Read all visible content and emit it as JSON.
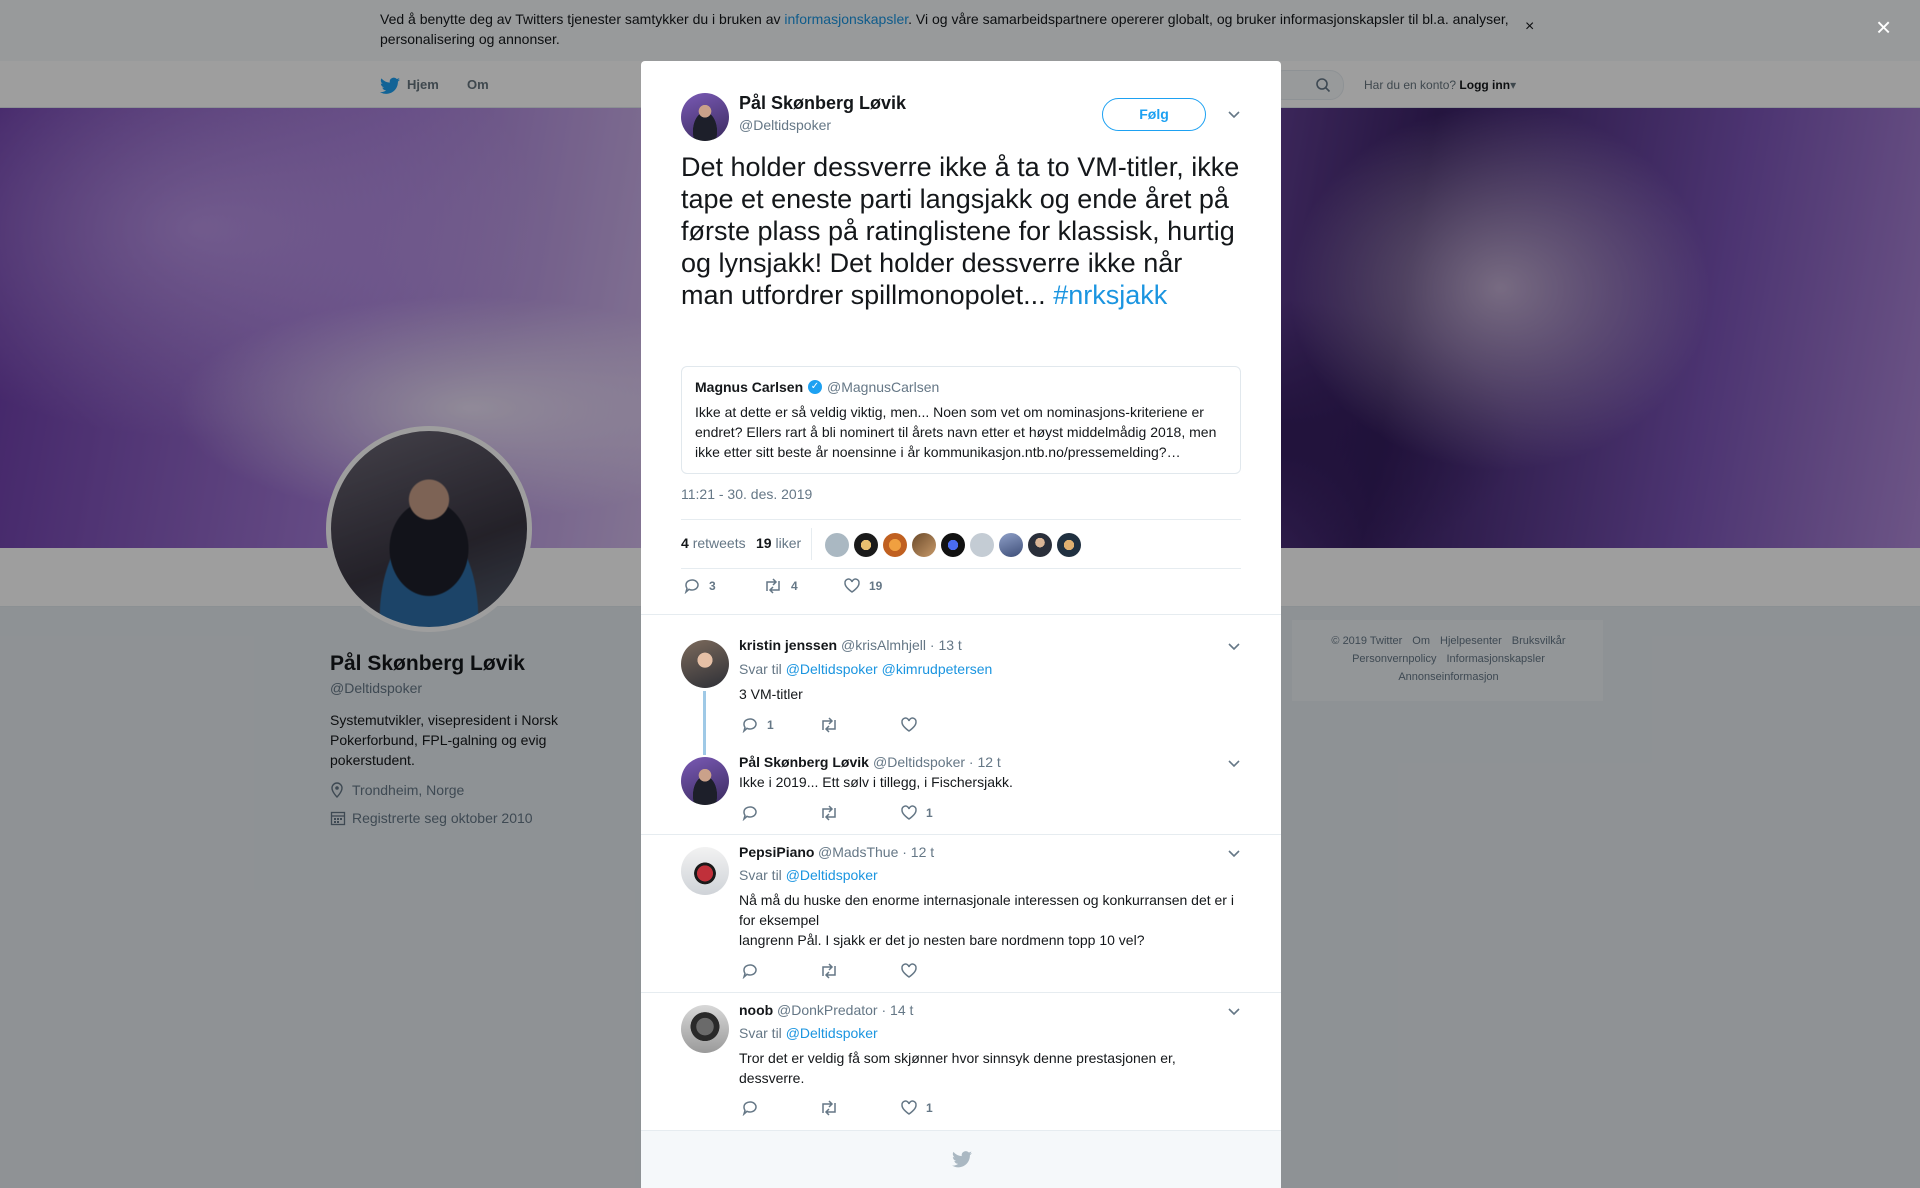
{
  "cookie_bar": {
    "text_before": "Ved å benytte deg av Twitters tjenester samtykker du i bruken av ",
    "link": "informasjonskapsler",
    "text_after": ". Vi og våre samarbeidspartnere opererer globalt, og bruker informasjonskapsler til bl.a. analyser, personalisering og annonser.",
    "close": "×"
  },
  "nav": {
    "home": "Hjem",
    "about": "Om",
    "login_prompt": "Har du en konto?",
    "login": "Logg inn"
  },
  "profile": {
    "name": "Pål Skønberg Løvik",
    "handle": "@Deltidspoker",
    "bio": "Systemutvikler, visepresident i Norsk Pokerforbund, FPL-galning og evig pokerstudent.",
    "location": "Trondheim, Norge",
    "joined": "Registrerte seg oktober 2010"
  },
  "footer": {
    "links": [
      "© 2019 Twitter",
      "Om",
      "Hjelpesenter",
      "Bruksvilkår",
      "Personvernpolicy",
      "Informasjonskapsler",
      "Annonseinformasjon"
    ]
  },
  "page_close": "×",
  "tweet": {
    "author_name": "Pål Skønberg Løvik",
    "author_handle": "@Deltidspoker",
    "follow": "Følg",
    "text": "Det holder dessverre ikke å ta to VM-titler, ikke tape et eneste parti langsjakk og ende året på første plass på ratinglistene for klassisk, hurtig og lynsjakk! Det holder dessverre ikke når man utfordrer spillmonopolet... ",
    "hashtag": "#nrksjakk",
    "quote": {
      "name": "Magnus Carlsen",
      "verified": "✓",
      "handle": "@MagnusCarlsen",
      "text": "Ikke at dette er så veldig viktig, men... Noen som vet om nominasjons-kriteriene er endret? Ellers rart å bli nominert til årets navn etter et høyst middelmådig 2018, men ikke etter sitt beste år noensinne i år kommunikasjon.ntb.no/pressemelding?…"
    },
    "timestamp": "11:21 - 30. des. 2019",
    "retweets_count": "4",
    "retweets_label": "retweets",
    "likes_count": "19",
    "likes_label": "liker",
    "actions": {
      "reply": "3",
      "retweet": "4",
      "like": "19"
    }
  },
  "replies": [
    {
      "name": "kristin jenssen",
      "handle": "@krisAlmhjell",
      "time": "· 13 t",
      "reply_to_label": "Svar til",
      "reply_to": "@Deltidspoker @kimrudpetersen",
      "text": "3 VM-titler",
      "reply_count": "1",
      "retweet_count": "",
      "like_count": ""
    },
    {
      "name": "Pål Skønberg Løvik",
      "handle": "@Deltidspoker",
      "time": "· 12 t",
      "text": "Ikke i 2019... Ett sølv i tillegg, i Fischersjakk.",
      "reply_count": "",
      "retweet_count": "",
      "like_count": "1"
    },
    {
      "name": "PepsiPiano",
      "handle": "@MadsThue",
      "time": "· 12 t",
      "reply_to_label": "Svar til",
      "reply_to": "@Deltidspoker",
      "text_line1": "Nå må du huske den enorme internasjonale interessen og konkurransen det er i for eksempel",
      "text_line2": "langrenn Pål. I sjakk er det jo nesten bare nordmenn topp 10 vel?",
      "reply_count": "",
      "retweet_count": "",
      "like_count": ""
    },
    {
      "name": "noob",
      "handle": "@DonkPredator",
      "time": "· 14 t",
      "reply_to_label": "Svar til",
      "reply_to": "@Deltidspoker",
      "text": "Tror det er veldig få som skjønner hvor sinnsyk denne prestasjonen er, dessverre.",
      "reply_count": "",
      "retweet_count": "",
      "like_count": "1"
    }
  ]
}
